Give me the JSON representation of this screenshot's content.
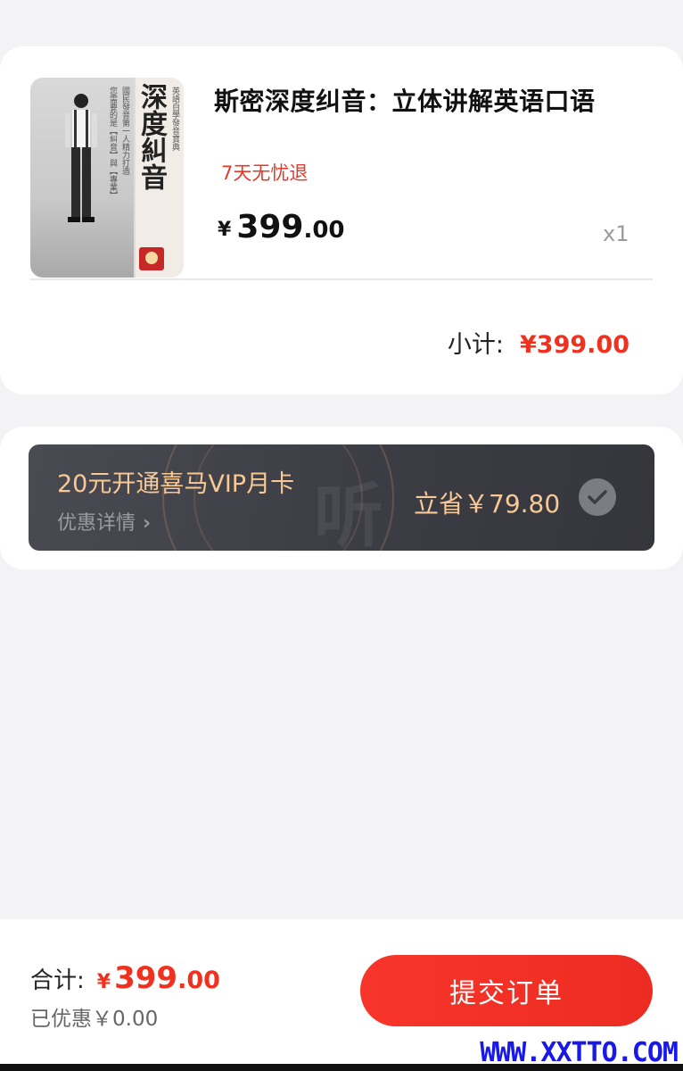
{
  "order": {
    "cover": {
      "title": "深度糾音",
      "side_text": "英語自學發音寶典",
      "col_1": "國民發音第一人精力打造",
      "col_2": "您需要的是【糾音】與【專業】"
    },
    "product_title": "斯密深度纠音：立体讲解英语口语",
    "refund_tag": "7天无忧退",
    "price_symbol": "¥",
    "price_int": "399",
    "price_dec": ".00",
    "quantity": "x1",
    "subtotal_label": "小计:",
    "subtotal_value": "¥399.00"
  },
  "vip": {
    "title": "20元开通喜马VIP月卡",
    "detail_label": "优惠详情",
    "detail_chevron": "›",
    "save_text": "立省￥79.80",
    "checked": true,
    "watermark": "听"
  },
  "footer": {
    "total_label": "合计:",
    "total_symbol": "¥",
    "total_int": "399",
    "total_dec": ".00",
    "discount_text": "已优惠￥0.00",
    "submit_label": "提交订单"
  },
  "site_watermark": "WWW.XXTTO.COM",
  "colors": {
    "accent_red": "#f0311f",
    "vip_gold": "#f7c995",
    "vip_bg": "#3c3c44",
    "page_bg": "#f3f3f5"
  },
  "icons": [
    "chevron-right-icon",
    "check-icon"
  ]
}
